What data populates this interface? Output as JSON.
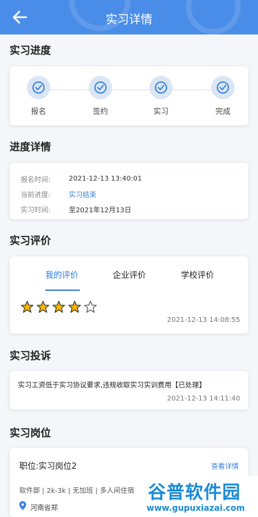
{
  "header": {
    "title": "实习详情"
  },
  "progress": {
    "section_title": "实习进度",
    "steps": [
      {
        "label": "报名"
      },
      {
        "label": "签约"
      },
      {
        "label": "实习"
      },
      {
        "label": "完成"
      }
    ]
  },
  "details": {
    "section_title": "进度详情",
    "rows": [
      {
        "key": "报名时间:",
        "value": "2021-12-13 13:40:01"
      },
      {
        "key": "当前进度:",
        "value": "实习结束"
      },
      {
        "key": "实习时间:",
        "value": "至2021年12月13日"
      }
    ]
  },
  "evaluation": {
    "section_title": "实习评价",
    "tabs": [
      "我的评价",
      "企业评价",
      "学校评价"
    ],
    "active_tab": "我的评价",
    "rating": 4,
    "rating_max": 5,
    "time": "2021-12-13 14:08:55"
  },
  "complaint": {
    "section_title": "实习投诉",
    "text": "实习工资低于实习协议要求,违规收取实习实训费用【已处理】",
    "time": "2021-12-13 14:11:40"
  },
  "position": {
    "section_title": "实习岗位",
    "title": "职位:实习岗位2",
    "link": "查看详情",
    "tags": "软件部 | 2k-3k | 无加班 | 多人间住宿",
    "location": "河南省郑"
  },
  "watermark": {
    "main": "谷普软件园",
    "sub": "www.gupuxiazai.com"
  },
  "colors": {
    "primary": "#4a8de8",
    "link": "#3b82d6",
    "star": "#f5b400"
  }
}
